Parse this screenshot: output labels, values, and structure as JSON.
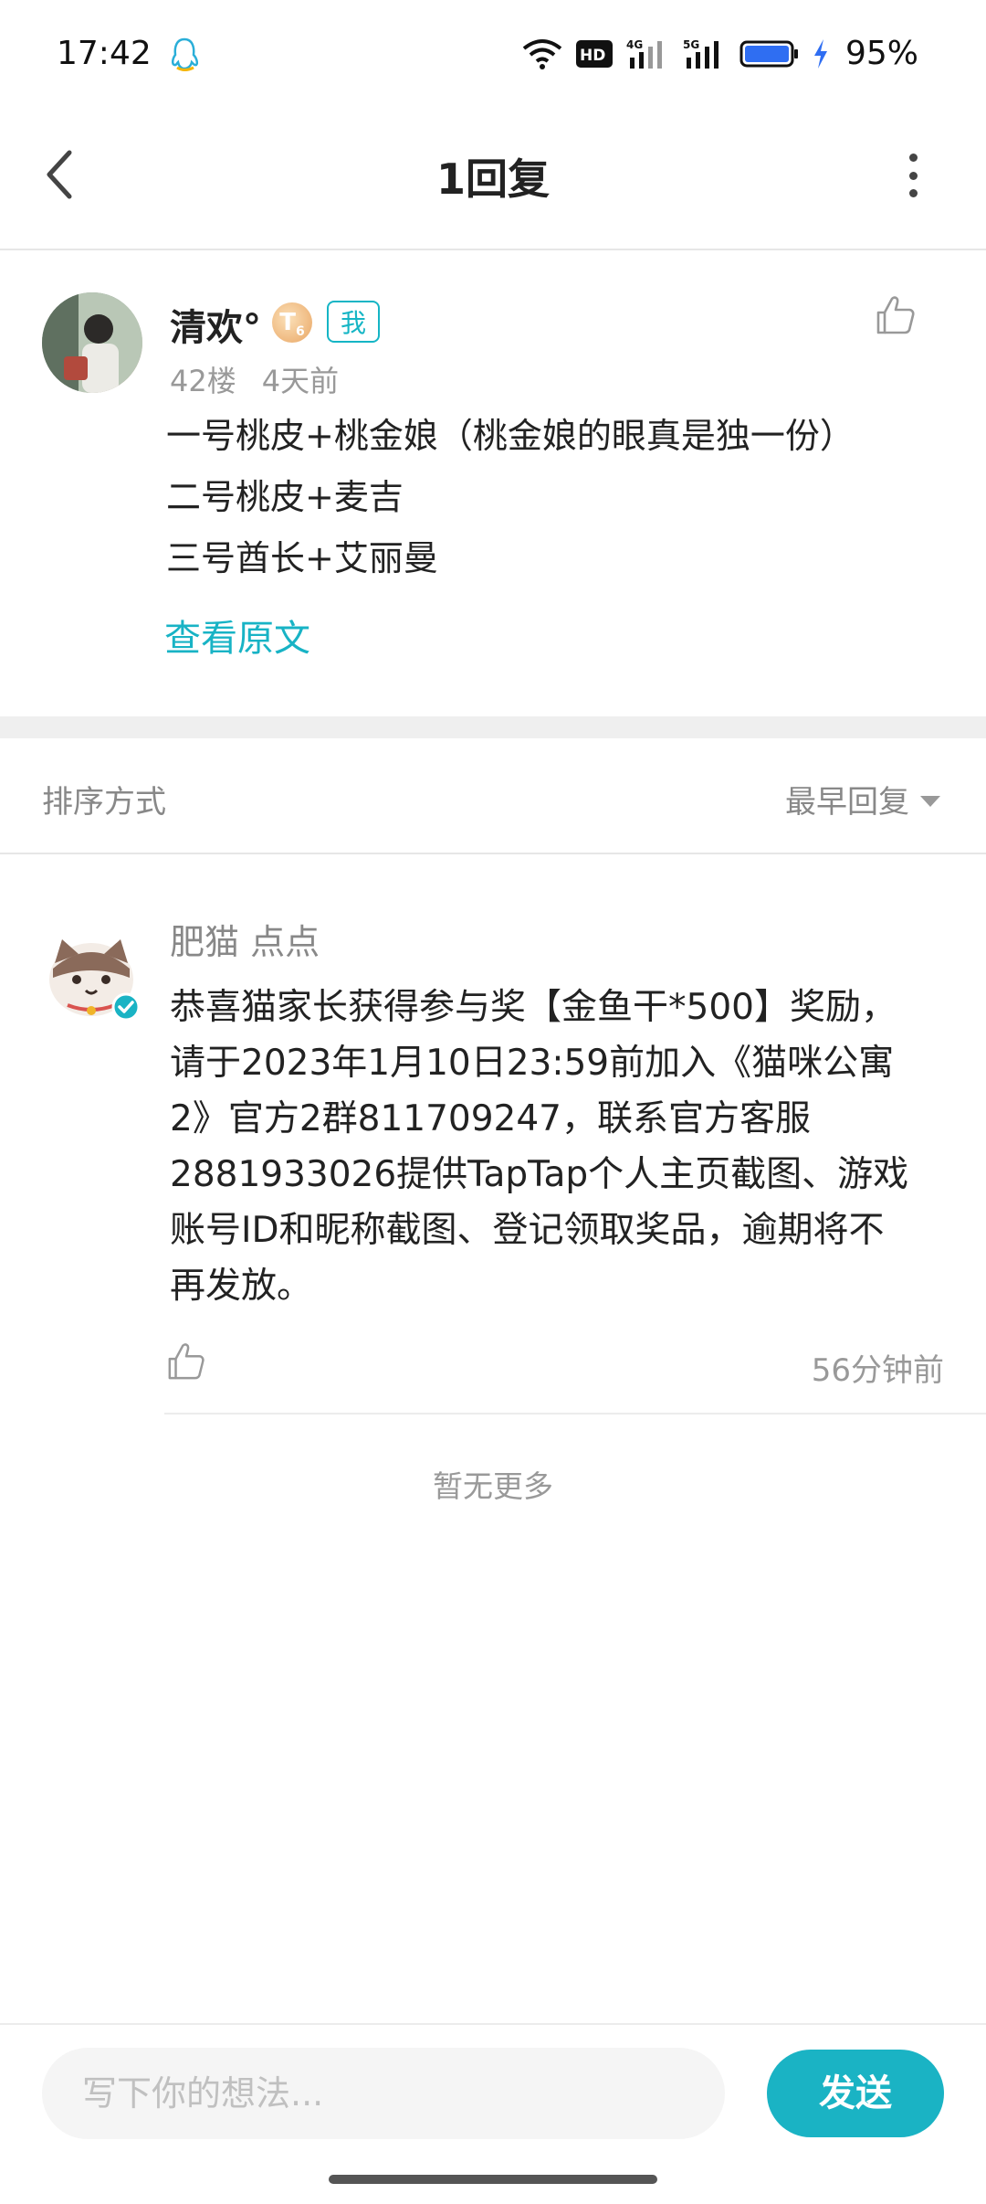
{
  "status_bar": {
    "time": "17:42",
    "battery": "95%",
    "icons": [
      "qq-icon",
      "wifi-icon",
      "hd-icon",
      "4g-signal-icon",
      "5g-signal-icon",
      "battery-icon",
      "charging-icon"
    ]
  },
  "header": {
    "title": "1回复",
    "back_icon": "back-arrow-icon",
    "more_icon": "more-vertical-icon"
  },
  "post": {
    "username": "清欢°",
    "level": "T",
    "level_num": "6",
    "me_label": "我",
    "floor": "42楼",
    "time": "4天前",
    "lines": [
      "一号桃皮+桃金娘（桃金娘的眼真是独一份）",
      "二号桃皮+麦吉",
      "三号酋长+艾丽曼"
    ],
    "view_original": "查看原文"
  },
  "sort": {
    "label": "排序方式",
    "selected": "最早回复"
  },
  "reply": {
    "username": "肥猫 点点",
    "lines": [
      "恭喜猫家长获得参与奖【金鱼干*500】奖励，",
      "请于2023年1月10日23:59前加入《猫咪公寓",
      "2》官方2群811709247，联系官方客服",
      "2881933026提供TapTap个人主页截图、游戏",
      "账号ID和昵称截图、登记领取奖品，逾期将不",
      "再发放。"
    ],
    "time": "56分钟前"
  },
  "no_more": "暂无更多",
  "input": {
    "placeholder": "写下你的想法...",
    "value": ""
  },
  "send_label": "发送",
  "colors": {
    "accent": "#1ab3c4",
    "muted_text": "#999999",
    "band": "#efefef"
  }
}
